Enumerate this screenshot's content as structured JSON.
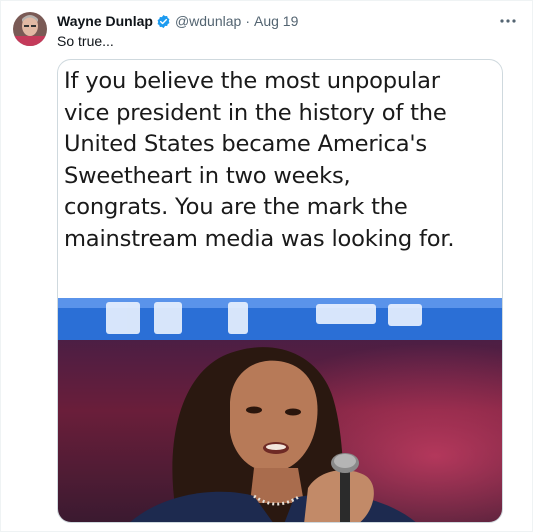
{
  "tweet": {
    "author_name": "Wayne Dunlap",
    "handle": "@wdunlap",
    "separator": "·",
    "date": "Aug 19",
    "text": "So true...",
    "more_icon": "more-horizontal-icon",
    "verified_icon": "verified-badge-icon",
    "verified_color": "#1d9bf0"
  },
  "media": {
    "caption_lines": [
      "If you believe the most unpopular",
      "vice president in the history of the",
      "United States became America's",
      "Sweetheart in two weeks,",
      "congrats. You are the mark the",
      "mainstream media was looking for."
    ],
    "photo_label": "photo of woman speaking into microphone"
  }
}
